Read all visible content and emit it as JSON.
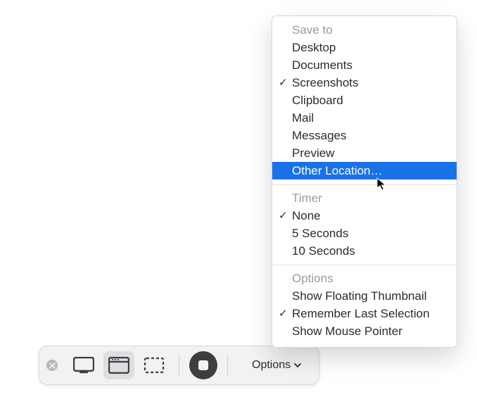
{
  "toolbar": {
    "options_label": "Options"
  },
  "menu": {
    "sections": [
      {
        "title": "Save to",
        "items": [
          {
            "label": "Desktop",
            "checked": false,
            "highlight": false
          },
          {
            "label": "Documents",
            "checked": false,
            "highlight": false
          },
          {
            "label": "Screenshots",
            "checked": true,
            "highlight": false
          },
          {
            "label": "Clipboard",
            "checked": false,
            "highlight": false
          },
          {
            "label": "Mail",
            "checked": false,
            "highlight": false
          },
          {
            "label": "Messages",
            "checked": false,
            "highlight": false
          },
          {
            "label": "Preview",
            "checked": false,
            "highlight": false
          },
          {
            "label": "Other Location…",
            "checked": false,
            "highlight": true
          }
        ]
      },
      {
        "title": "Timer",
        "items": [
          {
            "label": "None",
            "checked": true,
            "highlight": false
          },
          {
            "label": "5 Seconds",
            "checked": false,
            "highlight": false
          },
          {
            "label": "10 Seconds",
            "checked": false,
            "highlight": false
          }
        ]
      },
      {
        "title": "Options",
        "items": [
          {
            "label": "Show Floating Thumbnail",
            "checked": false,
            "highlight": false
          },
          {
            "label": "Remember Last Selection",
            "checked": true,
            "highlight": false
          },
          {
            "label": "Show Mouse Pointer",
            "checked": false,
            "highlight": false
          }
        ]
      }
    ]
  }
}
